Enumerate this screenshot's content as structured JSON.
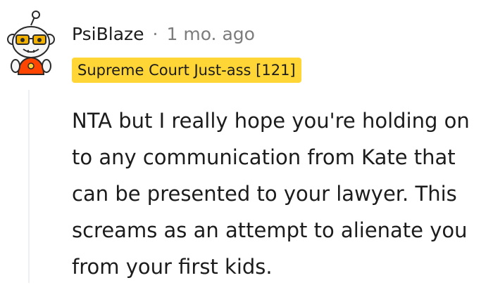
{
  "comment": {
    "author": "PsiBlaze",
    "separator": "·",
    "timestamp": "1 mo. ago",
    "flair": "Supreme Court Just-ass [121]",
    "body": "NTA but I really hope you're holding on to any communication from Kate that can be presented to your lawyer. This screams as an attempt to alienate you from your first kids."
  },
  "avatar": {
    "icon": "snoo-avatar-icon",
    "colors": {
      "head": "#f5f5f5",
      "glasses": "#f2b100",
      "shirt": "#ff4500"
    }
  },
  "colors": {
    "flair_bg": "#ffd635",
    "meta_text": "#7c7c7c",
    "body_text": "#1c1c1c",
    "thread_line": "#edeff1"
  }
}
